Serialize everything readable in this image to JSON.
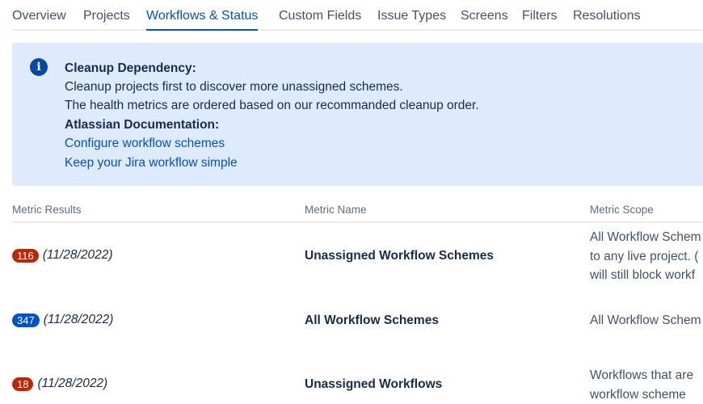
{
  "tabs": [
    {
      "label": "Overview"
    },
    {
      "label": "Projects"
    },
    {
      "label": "Workflows & Status",
      "active": true
    },
    {
      "label": "Custom Fields"
    },
    {
      "label": "Issue Types"
    },
    {
      "label": "Screens"
    },
    {
      "label": "Filters"
    },
    {
      "label": "Resolutions"
    }
  ],
  "info_panel": {
    "icon": "info-icon",
    "icon_glyph": "i",
    "heading": "Cleanup Dependency:",
    "lines": [
      "Cleanup projects first to discover more unassigned schemes.",
      "The health metrics are ordered based on our recommanded cleanup order."
    ],
    "docs_heading": "Atlassian Documentation:",
    "links": [
      "Configure workflow schemes",
      "Keep your Jira workflow simple"
    ]
  },
  "table": {
    "headers": {
      "results": "Metric Results",
      "name": "Metric Name",
      "scope": "Metric Scope"
    },
    "rows": [
      {
        "count": "116",
        "badge_color": "#bf2600",
        "date": "(11/28/2022)",
        "name": "Unassigned Workflow Schemes",
        "scope_lines": [
          "All Workflow Schem",
          "to any live project. (",
          "will still block workf"
        ]
      },
      {
        "count": "347",
        "badge_color": "#0052cc",
        "date": "(11/28/2022)",
        "name": "All Workflow Schemes",
        "scope_lines": [
          "All Workflow Schem"
        ]
      },
      {
        "count": "18",
        "badge_color": "#bf2600",
        "date": "(11/28/2022)",
        "name": "Unassigned Workflows",
        "scope_lines": [
          "Workflows that are",
          "workflow scheme"
        ]
      }
    ]
  },
  "colors": {
    "accent": "#0052cc",
    "panel_bg": "#deebff",
    "danger": "#bf2600"
  }
}
